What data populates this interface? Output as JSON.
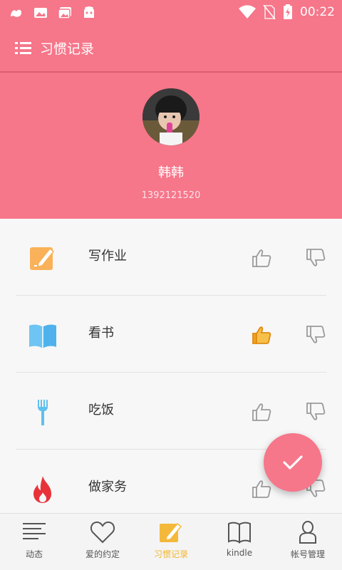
{
  "status_bar": {
    "time": "00:22",
    "icons": [
      "app-notification-icon",
      "image-notification-icon",
      "gallery-notification-icon",
      "android-notification-icon",
      "wifi-icon",
      "no-sim-icon",
      "battery-charging-icon"
    ]
  },
  "app_bar": {
    "title": "习惯记录",
    "menu_icon": "list-menu-icon"
  },
  "profile": {
    "name": "韩韩",
    "phone": "1392121520"
  },
  "habits": [
    {
      "label": "写作业",
      "icon": "pencil-note-icon",
      "liked": false
    },
    {
      "label": "看书",
      "icon": "open-book-icon",
      "liked": true
    },
    {
      "label": "吃饭",
      "icon": "fork-icon",
      "liked": false
    },
    {
      "label": "做家务",
      "icon": "fire-icon",
      "liked": false
    }
  ],
  "fab": {
    "icon": "checkmark-icon"
  },
  "bottom_nav": [
    {
      "label": "动态",
      "icon": "lines-icon",
      "active": false
    },
    {
      "label": "爱的约定",
      "icon": "heart-icon",
      "active": false
    },
    {
      "label": "习惯记录",
      "icon": "pencil-note-icon",
      "active": true
    },
    {
      "label": "kindle",
      "icon": "book-icon",
      "active": false
    },
    {
      "label": "帐号管理",
      "icon": "person-icon",
      "active": false
    }
  ],
  "colors": {
    "primary": "#f6768a",
    "active_nav": "#f2b62b",
    "like_active": "#f0a020"
  }
}
